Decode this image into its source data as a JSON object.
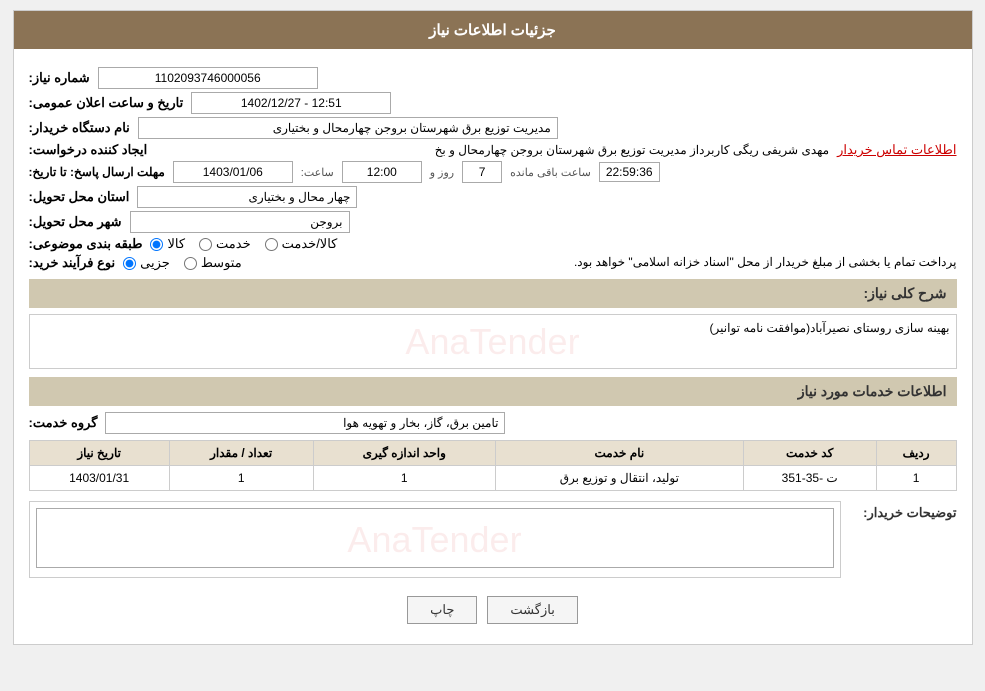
{
  "page": {
    "title": "جزئیات اطلاعات نیاز"
  },
  "header": {
    "shomara_label": "شماره نیاز:",
    "shomara_value": "1102093746000056",
    "tarikh_label": "تاریخ و ساعت اعلان عمومی:",
    "tarikh_value": "1402/12/27 - 12:51",
    "nam_dasgah_label": "نام دستگاه خریدار:",
    "nam_dasgah_value": "مدیریت توزیع برق شهرستان بروجن چهارمحال و بختیاری",
    "ijad_label": "ایجاد کننده درخواست:",
    "ijad_value": "مهدی شریفی ریگی کاربرداز مدیریت توزیع برق شهرستان بروجن چهارمحال و بخ",
    "ijad_link": "اطلاعات تماس خریدار",
    "mohlat_label": "مهلت ارسال پاسخ: تا تاریخ:",
    "date_value": "1403/01/06",
    "time_label": "ساعت:",
    "time_value": "12:00",
    "rooz_label": "روز و",
    "rooz_value": "7",
    "baqi_label": "ساعت باقی مانده",
    "timer_value": "22:59:36",
    "ostan_label": "استان محل تحویل:",
    "ostan_value": "چهار محال و بختیاری",
    "shahr_label": "شهر محل تحویل:",
    "shahr_value": "بروجن",
    "tabaqe_label": "طبقه بندی موضوعی:",
    "radio_kala": "کالا",
    "radio_khadamat": "خدمت",
    "radio_kala_khadamat": "کالا/خدمت",
    "noe_label": "نوع فرآیند خرید:",
    "radio_jozi": "جزیی",
    "radio_motevaset": "متوسط",
    "noe_text": "پرداخت تمام یا بخشی از مبلغ خریدار از محل \"اسناد خزانه اسلامی\" خواهد بود.",
    "sharh_label": "شرح کلی نیاز:",
    "sharh_value": "بهینه سازی روستای نصیرآباد(موافقت نامه توانیر)",
    "service_section": "اطلاعات خدمات مورد نیاز",
    "group_label": "گروه خدمت:",
    "group_value": "تامین برق، گاز، بخار و تهویه هوا",
    "table": {
      "headers": [
        "ردیف",
        "کد خدمت",
        "نام خدمت",
        "واحد اندازه گیری",
        "تعداد / مقدار",
        "تاریخ نیاز"
      ],
      "rows": [
        {
          "radif": "1",
          "code": "ت -35-351",
          "name": "تولید، انتقال و توزیع برق",
          "unit": "1",
          "count": "1",
          "date": "1403/01/31"
        }
      ]
    },
    "tawsif_label": "توضیحات خریدار:",
    "tawsif_value": "",
    "btn_back": "بازگشت",
    "btn_print": "چاپ"
  }
}
